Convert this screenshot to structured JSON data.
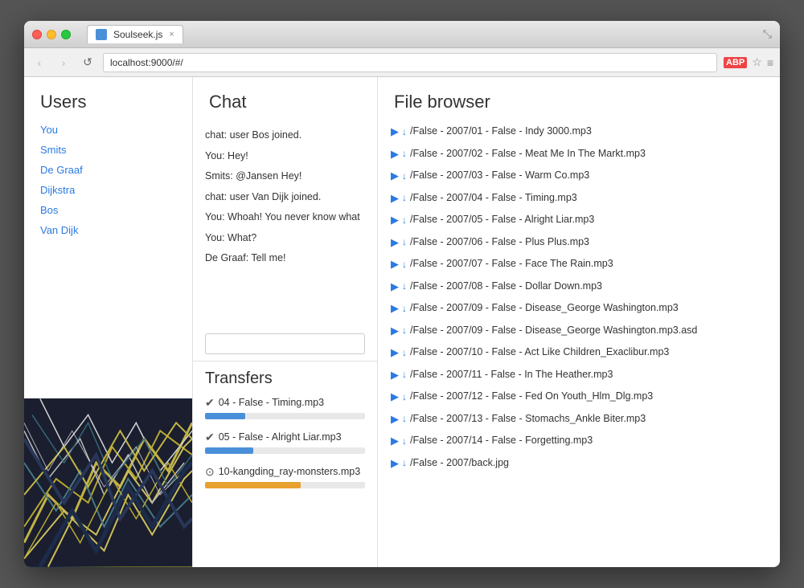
{
  "browser": {
    "tab_title": "Soulseek.js",
    "tab_close": "×",
    "address": "localhost:9000/#/",
    "window_resize": "⤡"
  },
  "nav": {
    "back": "‹",
    "forward": "›",
    "refresh": "↺"
  },
  "users": {
    "header": "Users",
    "list": [
      {
        "label": "You"
      },
      {
        "label": "Smits"
      },
      {
        "label": "De Graaf"
      },
      {
        "label": "Dijkstra"
      },
      {
        "label": "Bos"
      },
      {
        "label": "Van Dijk"
      }
    ]
  },
  "chat": {
    "header": "Chat",
    "messages": [
      {
        "text": "chat: user Bos joined."
      },
      {
        "text": "You: Hey!"
      },
      {
        "text": "Smits: @Jansen Hey!"
      },
      {
        "text": "chat: user Van Dijk joined."
      },
      {
        "text": "You: Whoah! You never know what"
      },
      {
        "text": "You: What?"
      },
      {
        "text": "De Graaf: Tell me!"
      }
    ],
    "input_placeholder": ""
  },
  "transfers": {
    "header": "Transfers",
    "items": [
      {
        "icon": "✔",
        "name": "04 - False - Timing.mp3",
        "progress": 25,
        "color": "blue"
      },
      {
        "icon": "✔",
        "name": "05 - False - Alright Liar.mp3",
        "progress": 30,
        "color": "blue"
      },
      {
        "icon": "⊙",
        "name": "10-kangding_ray-monsters.mp3",
        "progress": 60,
        "color": "orange"
      }
    ]
  },
  "filebrowser": {
    "header": "File browser",
    "files": [
      {
        "path": "/False - 2007/01 - False - Indy 3000.mp3"
      },
      {
        "path": "/False - 2007/02 - False - Meat Me In The Markt.mp3"
      },
      {
        "path": "/False - 2007/03 - False - Warm Co.mp3"
      },
      {
        "path": "/False - 2007/04 - False - Timing.mp3"
      },
      {
        "path": "/False - 2007/05 - False - Alright Liar.mp3"
      },
      {
        "path": "/False - 2007/06 - False - Plus Plus.mp3"
      },
      {
        "path": "/False - 2007/07 - False - Face The Rain.mp3"
      },
      {
        "path": "/False - 2007/08 - False - Dollar Down.mp3"
      },
      {
        "path": "/False - 2007/09 - False - Disease_George Washington.mp3"
      },
      {
        "path": "/False - 2007/09 - False - Disease_George Washington.mp3.asd"
      },
      {
        "path": "/False - 2007/10 - False - Act Like Children_Exaclibur.mp3"
      },
      {
        "path": "/False - 2007/11 - False - In The Heather.mp3"
      },
      {
        "path": "/False - 2007/12 - False - Fed On Youth_Hlm_Dlg.mp3"
      },
      {
        "path": "/False - 2007/13 - False - Stomachs_Ankle Biter.mp3"
      },
      {
        "path": "/False - 2007/14 - False - Forgetting.mp3"
      },
      {
        "path": "/False - 2007/back.jpg"
      }
    ]
  }
}
